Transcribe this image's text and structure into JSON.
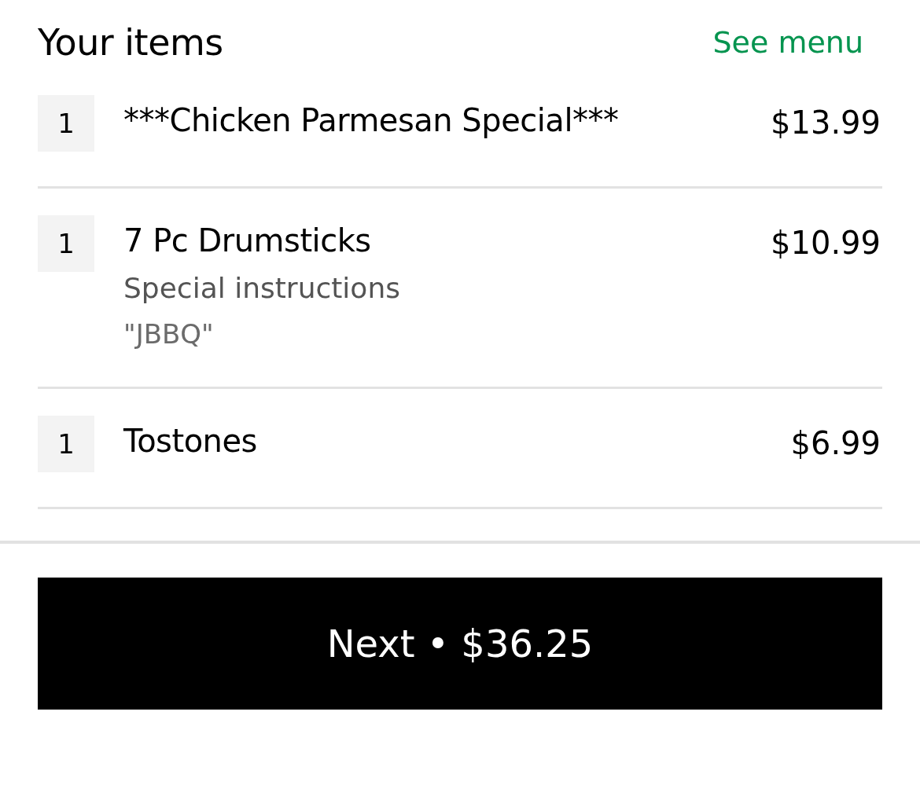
{
  "header": {
    "title": "Your items",
    "link": "See menu"
  },
  "items": [
    {
      "quantity": "1",
      "name": "***Chicken Parmesan Special***",
      "price": "$13.99"
    },
    {
      "quantity": "1",
      "name": "7 Pc Drumsticks",
      "price": "$10.99",
      "note_label": "Special instructions",
      "note": "\"JBBQ\""
    },
    {
      "quantity": "1",
      "name": "Tostones",
      "price": "$6.99"
    }
  ],
  "checkout_button": "Next • $36.25"
}
